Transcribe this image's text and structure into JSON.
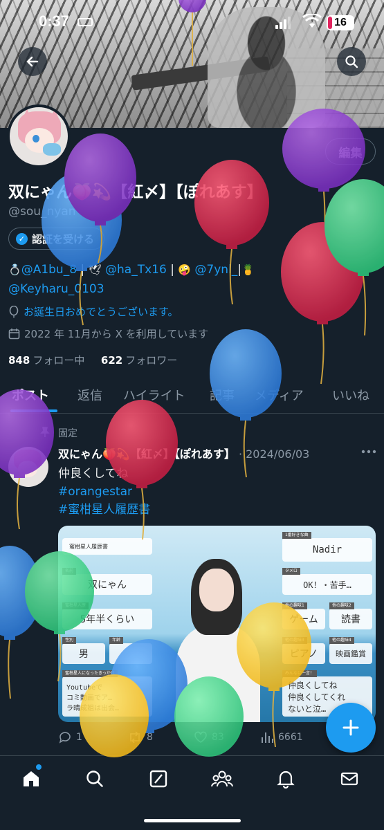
{
  "status_bar": {
    "time": "0:37",
    "battery": "16"
  },
  "header": {
    "back_icon": "arrow-left-icon",
    "search_icon": "search-icon"
  },
  "profile": {
    "name": "双にゃん🍑💫【紅〆】【ぽれあす】",
    "handle": "@sou_nyan",
    "edit_label": "編集",
    "verify_label": "認証を受ける",
    "bio_line1": [
      {
        "t": "💍",
        "k": "emo"
      },
      {
        "t": "@A1bu_8",
        "k": "link"
      },
      {
        "t": " | ",
        "k": "txt"
      },
      {
        "t": "🕊",
        "k": "emo"
      },
      {
        "t": " @ha_Tx16",
        "k": "link"
      },
      {
        "t": " | ",
        "k": "txt"
      },
      {
        "t": "🤪",
        "k": "emo"
      },
      {
        "t": " @7ynl_",
        "k": "link"
      },
      {
        "t": "|",
        "k": "txt"
      },
      {
        "t": "🍍",
        "k": "emo"
      }
    ],
    "bio_line2": "@Keyharu_0103",
    "birthday": "お誕生日おめでとうございます。",
    "joined": "2022 年 11月から X を利用しています",
    "following_count": "848",
    "following_label": "フォロー中",
    "followers_count": "622",
    "followers_label": "フォロワー"
  },
  "tabs": [
    "ポスト",
    "返信",
    "ハイライト",
    "記事",
    "メディア",
    "いいね"
  ],
  "post": {
    "pinned_label": "固定",
    "author": "双にゃん🍑💫【紅〆】【ぽれあす】",
    "date": "· 2024/06/03",
    "text": "仲良くしてね",
    "tags": [
      "#orangestar",
      "#蜜柑星人履歴書"
    ],
    "stats": {
      "replies": "1",
      "reposts": "8",
      "likes": "83",
      "views": "6661"
    },
    "media_cards": {
      "title": "蜜柑星人履歴書",
      "fav_song_label": "1番好きな曲",
      "fav_song": "Nadir",
      "name_label": "名前",
      "name": "双にゃん",
      "taimero_label": "タメロ",
      "taimero": "OK！・苦手…",
      "history_label": "蜜柑星人歴",
      "history": "5年半くらい",
      "hobby1_label": "他の趣味1",
      "hobby1": "ゲーム",
      "hobby2_label": "他の趣味2",
      "hobby2": "読書",
      "gender_label": "性別",
      "gender": "男",
      "age_label": "年齢",
      "age": "",
      "hobby3_label": "他の趣味3",
      "hobby3": "ピアノ",
      "hobby4_label": "他の趣味4",
      "hobby4": "映画鑑賞",
      "reason_label": "蜜柑星人になったきっかけ",
      "reason": "Youtubeで\nコミ動画でア…\nラ晴成姐は出会…",
      "message_label": "みんなに一言！",
      "message": "仲良くしてね\n仲良くしてくれ\nないと泣…"
    }
  },
  "nav": [
    "home-icon",
    "search-icon",
    "grok-icon",
    "communities-icon",
    "bell-icon",
    "mail-icon"
  ],
  "colors": {
    "accent": "#1d9bf0",
    "background": "#15202b",
    "muted": "#8b98a5"
  }
}
